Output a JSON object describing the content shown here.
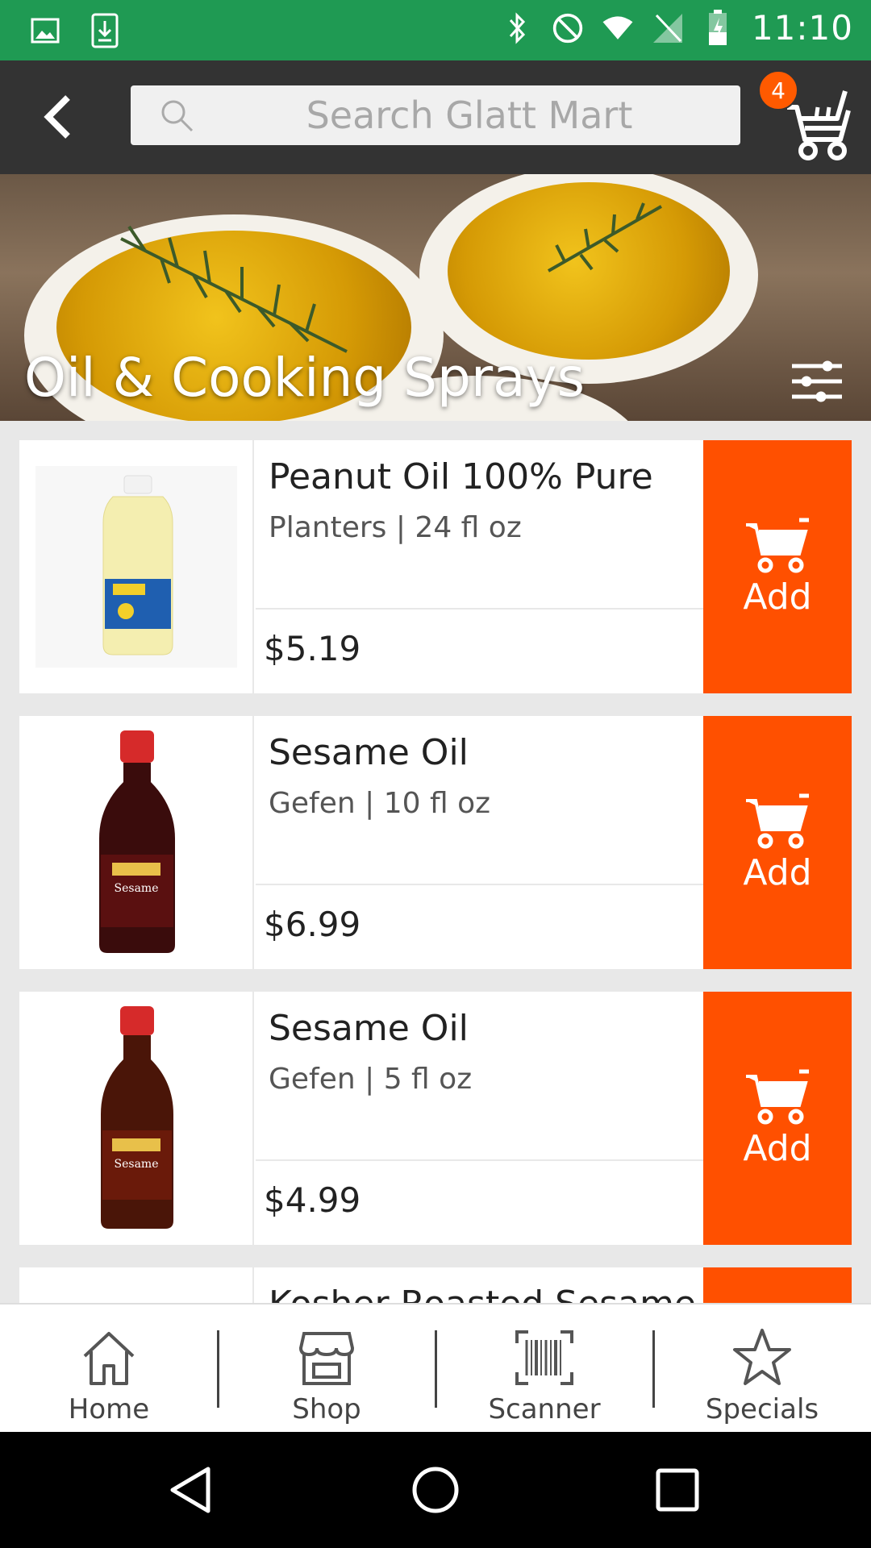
{
  "status_bar": {
    "time": "11:10",
    "left_icons": [
      "image-icon",
      "download-icon"
    ],
    "right_icons": [
      "bluetooth-icon",
      "do-not-disturb-icon",
      "wifi-icon",
      "no-sim-icon",
      "battery-icon"
    ]
  },
  "app_bar": {
    "search_placeholder": "Search Glatt Mart",
    "cart_count": "4"
  },
  "hero": {
    "title": "Oil & Cooking Sprays"
  },
  "products": [
    {
      "name": "Peanut Oil 100% Pure",
      "brand_size": "Planters | 24 fl oz",
      "price": "$5.19",
      "add_label": "Add"
    },
    {
      "name": "Sesame Oil",
      "brand_size": "Gefen | 10 fl oz",
      "price": "$6.99",
      "add_label": "Add"
    },
    {
      "name": "Sesame Oil",
      "brand_size": "Gefen | 5 fl oz",
      "price": "$4.99",
      "add_label": "Add"
    },
    {
      "name": "Kosher Roasted Sesame",
      "brand_size": "",
      "price": "",
      "add_label": ""
    }
  ],
  "bottom_nav": [
    {
      "label": "Home",
      "icon": "home-icon"
    },
    {
      "label": "Shop",
      "icon": "shop-icon"
    },
    {
      "label": "Scanner",
      "icon": "barcode-scanner-icon"
    },
    {
      "label": "Specials",
      "icon": "star-icon"
    }
  ],
  "colors": {
    "status_bar": "#1f9a53",
    "app_bar": "#333333",
    "accent": "#ff5000"
  }
}
